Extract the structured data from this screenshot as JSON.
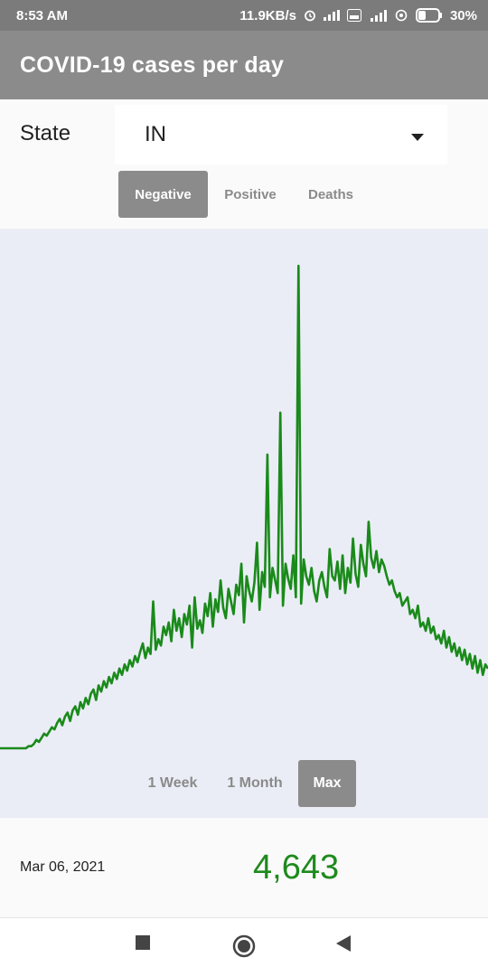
{
  "status_bar": {
    "time": "8:53 AM",
    "speed": "11.9KB/s",
    "battery": "30%",
    "icons": [
      "alarm-icon",
      "signal-icon",
      "volte-icon",
      "4g-signal-icon",
      "wifi-calling-icon",
      "battery-icon"
    ]
  },
  "app_bar": {
    "title": "COVID-19 cases per day"
  },
  "state": {
    "label": "State",
    "selected": "IN"
  },
  "tabs": [
    {
      "label": "Negative",
      "active": true
    },
    {
      "label": "Positive",
      "active": false
    },
    {
      "label": "Deaths",
      "active": false
    }
  ],
  "range_buttons": [
    {
      "label": "1 Week",
      "active": false
    },
    {
      "label": "1 Month",
      "active": false
    },
    {
      "label": "Max",
      "active": true
    }
  ],
  "summary": {
    "date": "Mar 06, 2021",
    "value": "4,643"
  },
  "colors": {
    "line": "#1a8a1a",
    "chart_bg": "#eaedf6",
    "accent": "#8b8b8b",
    "value": "#1e8a1e"
  },
  "chart_data": {
    "type": "line",
    "title": "",
    "xlabel": "",
    "ylabel": "",
    "grid": false,
    "series": [
      {
        "values": [
          0,
          0,
          0,
          0,
          0,
          0,
          0,
          0,
          0,
          0,
          0,
          1,
          1,
          2,
          4,
          3,
          5,
          7,
          6,
          8,
          10,
          9,
          12,
          14,
          11,
          15,
          17,
          13,
          18,
          20,
          16,
          22,
          19,
          24,
          21,
          26,
          28,
          23,
          30,
          27,
          32,
          29,
          34,
          31,
          36,
          33,
          38,
          35,
          40,
          37,
          42,
          39,
          44,
          41,
          46,
          50,
          43,
          48,
          45,
          70,
          47,
          52,
          49,
          58,
          54,
          60,
          51,
          66,
          56,
          62,
          53,
          64,
          59,
          68,
          48,
          72,
          57,
          61,
          55,
          69,
          63,
          74,
          58,
          71,
          65,
          80,
          67,
          62,
          76,
          70,
          64,
          78,
          73,
          88,
          60,
          82,
          75,
          70,
          79,
          98,
          66,
          84,
          77,
          140,
          72,
          86,
          80,
          74,
          160,
          68,
          88,
          81,
          76,
          92,
          72,
          230,
          69,
          90,
          82,
          78,
          86,
          75,
          70,
          80,
          84,
          77,
          72,
          95,
          82,
          80,
          89,
          76,
          92,
          74,
          86,
          79,
          100,
          83,
          77,
          97,
          88,
          82,
          108,
          91,
          86,
          94,
          84,
          90,
          87,
          82,
          78,
          80,
          75,
          72,
          74,
          68,
          70,
          72,
          64,
          66,
          62,
          68,
          58,
          60,
          56,
          62,
          55,
          58,
          52,
          54,
          50,
          56,
          48,
          53,
          46,
          50,
          44,
          48,
          42,
          47,
          40,
          45,
          38,
          44,
          36,
          42,
          35,
          40,
          38
        ]
      }
    ],
    "ylim": [
      0,
      240
    ]
  }
}
